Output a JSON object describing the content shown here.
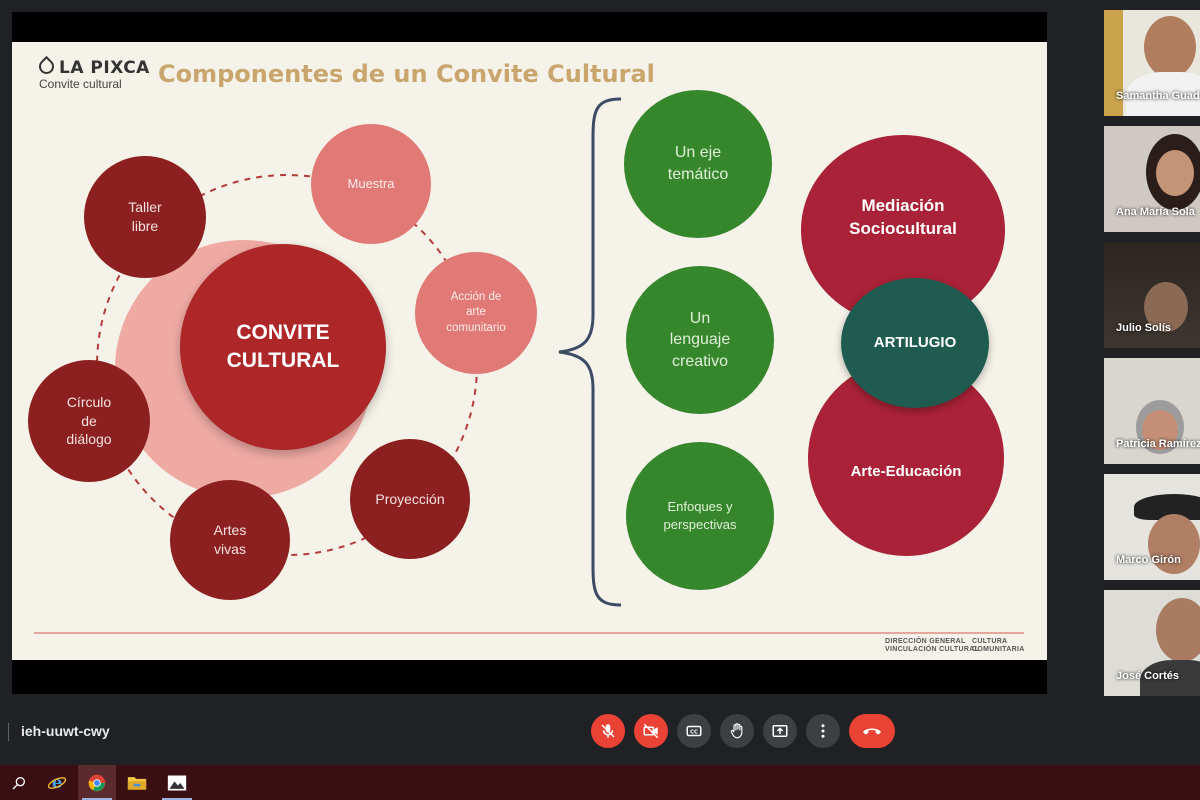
{
  "meeting": {
    "code": "ieh-uuwt-cwy"
  },
  "slide": {
    "logo_main": "LA PIXCA",
    "logo_sub": "Convite cultural",
    "title": "Componentes de un Convite Cultural",
    "center": "CONVITE\nCULTURAL",
    "orbit": [
      {
        "label": "Taller\nlibre",
        "style": "dark"
      },
      {
        "label": "Muestra",
        "style": "pink"
      },
      {
        "label": "Acción de\narte\ncomunitario",
        "style": "pink"
      },
      {
        "label": "Proyección",
        "style": "dark"
      },
      {
        "label": "Artes\nvivas",
        "style": "dark"
      },
      {
        "label": "Círculo\nde\ndiálogo",
        "style": "dark"
      }
    ],
    "green_items": [
      "Un eje\ntemático",
      "Un\nlenguaje\ncreativo",
      "Enfoques y\nperspectivas"
    ],
    "mediation": "Mediación\nSociocultural",
    "artilugio": "ARTILUGIO",
    "arte_educacion": "Arte-Educación",
    "footer_left": "DIRECCIÓN GENERAL\nVINCULACIÓN CULTURAL",
    "footer_right": "CULTURA\nCOMUNITARIA",
    "colors": {
      "dark_red": "#8c1f1f",
      "pink": "#e17a76",
      "green": "#36862c",
      "crimson": "#aa2237",
      "teal": "#1f5b4f",
      "title_gold": "#c8a66e"
    }
  },
  "participants": [
    {
      "name": "Samantha Guad"
    },
    {
      "name": "Ana María Sola"
    },
    {
      "name": "Julio Solís"
    },
    {
      "name": "Patricia Ramírez"
    },
    {
      "name": "Marco Girón"
    },
    {
      "name": "José Cortés"
    }
  ],
  "controls": [
    {
      "name": "mic-off-icon"
    },
    {
      "name": "camera-off-icon"
    },
    {
      "name": "captions-icon"
    },
    {
      "name": "raise-hand-icon"
    },
    {
      "name": "present-screen-icon"
    },
    {
      "name": "more-options-icon"
    },
    {
      "name": "end-call-icon"
    }
  ],
  "taskbar": [
    {
      "name": "search-icon"
    },
    {
      "name": "internet-explorer-icon"
    },
    {
      "name": "chrome-icon"
    },
    {
      "name": "file-explorer-icon"
    },
    {
      "name": "photos-icon"
    }
  ]
}
